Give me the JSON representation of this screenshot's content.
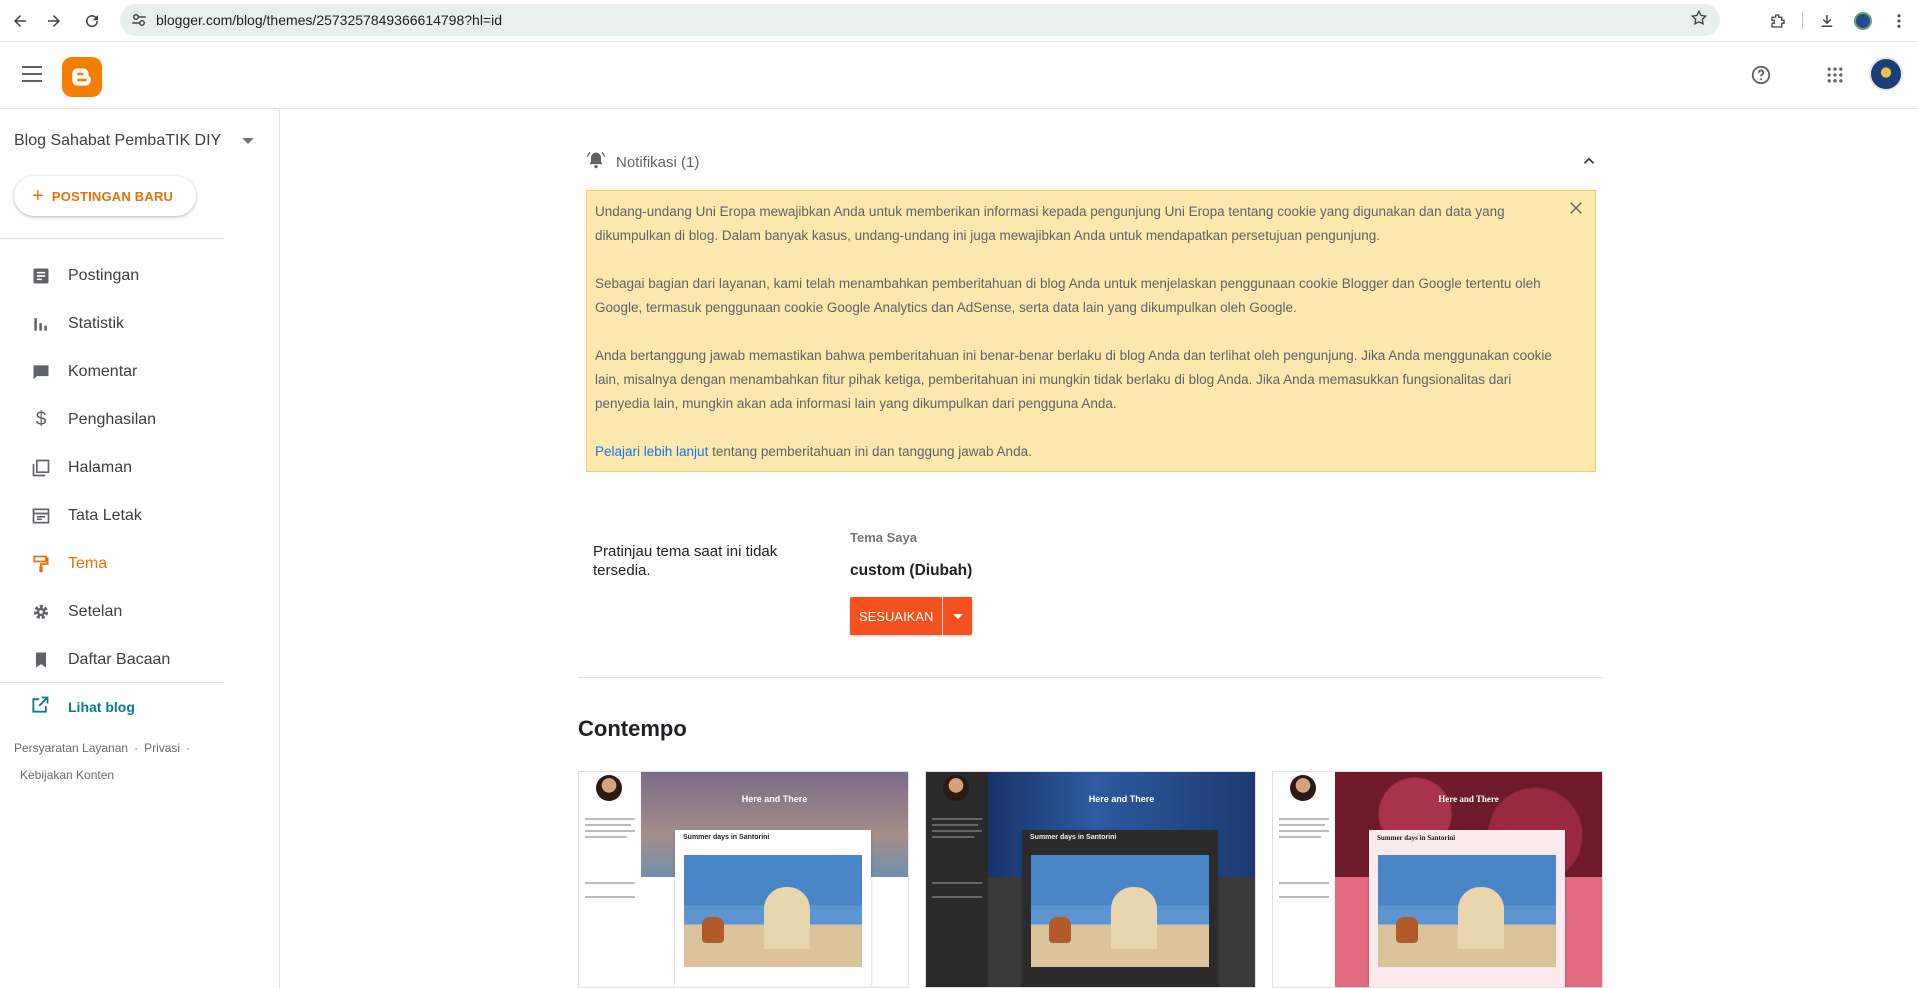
{
  "browser": {
    "url": "blogger.com/blog/themes/2573257849366614798?hl=id"
  },
  "sidebar": {
    "blog_name": "Blog Sahabat PembaTIK DIY",
    "new_post_label": "POSTINGAN BARU",
    "items": [
      {
        "label": "Postingan",
        "icon": "posts-icon"
      },
      {
        "label": "Statistik",
        "icon": "stats-icon"
      },
      {
        "label": "Komentar",
        "icon": "comment-icon"
      },
      {
        "label": "Penghasilan",
        "icon": "dollar-icon"
      },
      {
        "label": "Halaman",
        "icon": "pages-icon"
      },
      {
        "label": "Tata Letak",
        "icon": "layout-icon"
      },
      {
        "label": "Tema",
        "icon": "theme-icon"
      },
      {
        "label": "Setelan",
        "icon": "gear-icon"
      },
      {
        "label": "Daftar Bacaan",
        "icon": "bookmark-icon"
      }
    ],
    "active_item": "Tema",
    "view_blog_label": "Lihat blog",
    "footer": {
      "terms": "Persyaratan Layanan",
      "privacy": "Privasi",
      "content_policy": "Kebijakan Konten"
    }
  },
  "notification": {
    "title": "Notifikasi (1)",
    "paragraphs": [
      "Undang-undang Uni Eropa mewajibkan Anda untuk memberikan informasi kepada pengunjung Uni Eropa tentang cookie yang digunakan dan data yang dikumpulkan di blog. Dalam banyak kasus, undang-undang ini juga mewajibkan Anda untuk mendapatkan persetujuan pengunjung.",
      "Sebagai bagian dari layanan, kami telah menambahkan pemberitahuan di blog Anda untuk menjelaskan penggunaan cookie Blogger dan Google tertentu oleh Google, termasuk penggunaan cookie Google Analytics dan AdSense, serta data lain yang dikumpulkan oleh Google.",
      "Anda bertanggung jawab memastikan bahwa pemberitahuan ini benar-benar berlaku di blog Anda dan terlihat oleh pengunjung. Jika Anda menggunakan cookie lain, misalnya dengan menambahkan fitur pihak ketiga, pemberitahuan ini mungkin tidak berlaku di blog Anda. Jika Anda memasukkan fungsionalitas dari penyedia lain, mungkin akan ada informasi lain yang dikumpulkan dari pengguna Anda."
    ],
    "learn_more_link": "Pelajari lebih lanjut",
    "learn_more_rest": " tentang pemberitahuan ini dan tanggung jawab Anda."
  },
  "theme": {
    "preview_unavailable": "Pratinjau tema saat ini tidak tersedia.",
    "my_theme_label": "Tema Saya",
    "current_theme": "custom (Diubah)",
    "customize_label": "SESUAIKAN"
  },
  "gallery": {
    "section_title": "Contempo",
    "thumbnails": [
      {
        "blog_title": "Here and There",
        "post_title": "Summer days in Santorini",
        "hero_color": "#8a7a86",
        "side_color": "#ffffff",
        "body_color": "#f3f3f3"
      },
      {
        "blog_title": "Here and There",
        "post_title": "Summer days in Santorini",
        "hero_color": "#1f3f7a",
        "side_color": "#2a2a2a",
        "body_color": "#3a3a3a"
      },
      {
        "blog_title": "Here and There",
        "post_title": "Summer days in Santorini",
        "hero_color": "#7a1f2e",
        "side_color": "#ffffff",
        "body_color": "#e26a7e"
      }
    ]
  }
}
